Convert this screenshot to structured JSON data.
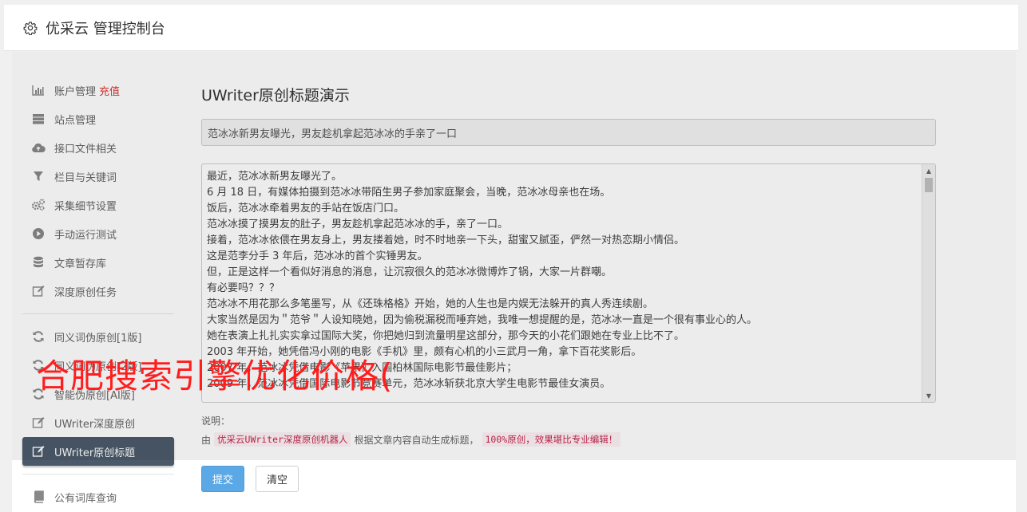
{
  "header": {
    "title": "优采云 管理控制台"
  },
  "sidebar": {
    "items": [
      {
        "label": "账户管理",
        "badge": "充值",
        "icon": "bar-chart-icon"
      },
      {
        "label": "站点管理",
        "icon": "server-icon"
      },
      {
        "label": "接口文件相关",
        "icon": "cloud-upload-icon"
      },
      {
        "label": "栏目与关键词",
        "icon": "filter-icon"
      },
      {
        "label": "采集细节设置",
        "icon": "cogs-icon"
      },
      {
        "label": "手动运行测试",
        "icon": "play-circle-icon"
      },
      {
        "label": "文章暂存库",
        "icon": "database-icon"
      },
      {
        "label": "深度原创任务",
        "icon": "edit-icon"
      }
    ],
    "items2": [
      {
        "label": "同义词伪原创[1版]",
        "icon": "refresh-icon"
      },
      {
        "label": "同义词伪原创[2版]",
        "icon": "refresh-icon"
      },
      {
        "label": "智能伪原创[AI版]",
        "icon": "refresh-icon"
      },
      {
        "label": "UWriter深度原创",
        "icon": "edit-icon"
      },
      {
        "label": "UWriter原创标题",
        "icon": "edit-icon",
        "active": true
      }
    ],
    "items3": [
      {
        "label": "公有词库查询",
        "icon": "book-icon"
      }
    ]
  },
  "main": {
    "section_title": "UWriter原创标题演示",
    "title_value": "范冰冰新男友曝光，男友趁机拿起范冰冰的手亲了一口",
    "article_lines": [
      "最近，范冰冰新男友曝光了。",
      "6 月 18 日，有媒体拍摄到范冰冰带陌生男子参加家庭聚会，当晚，范冰冰母亲也在场。",
      "饭后，范冰冰牵着男友的手站在饭店门口。",
      "范冰冰摸了摸男友的肚子，男友趁机拿起范冰冰的手，亲了一口。",
      "接着，范冰冰依偎在男友身上，男友搂着她，时不时地亲一下头，甜蜜又腻歪，俨然一对热恋期小情侣。",
      "这是范李分手 3 年后，范冰冰的首个实锤男友。",
      "但，正是这样一个看似好消息的消息，让沉寂很久的范冰冰微博炸了锅，大家一片群嘲。",
      "有必要吗？？？",
      "范冰冰不用花那么多笔墨写，从《还珠格格》开始，她的人生也是内娱无法躲开的真人秀连续剧。",
      "大家当然是因为＂范爷＂人设知晓她，因为偷税漏税而唾弃她，我唯一想提醒的是，范冰冰一直是一个很有事业心的人。",
      "她在表演上扎扎实实拿过国际大奖，你把她归到流量明星这部分，那今天的小花们跟她在专业上比不了。",
      "2003 年开始，她凭借冯小刚的电影《手机》里，颇有心机的小三武月一角，拿下百花奖影后。",
      "2007 年，范冰冰凭借电影《苹果》入围柏林国际电影节最佳影片；",
      "2009 年，范冰冰凭借国际电影节竞赛单元，范冰冰斩获北京大学生电影节最佳女演员。"
    ],
    "note_label": "说明：",
    "note_prefix": "由",
    "note_robot": "优采云UWriter深度原创机器人",
    "note_middle": "根据文章内容自动生成标题，",
    "note_highlight": "100%原创，效果堪比专业编辑！",
    "submit_label": "提交",
    "clear_label": "清空"
  },
  "watermark": "合肥搜索引擎优化价格(",
  "colors": {
    "accent": "#5aa9e6",
    "active_nav": "#4b5a6b",
    "recharge": "#e0322e",
    "watermark": "#ff1d1d"
  }
}
